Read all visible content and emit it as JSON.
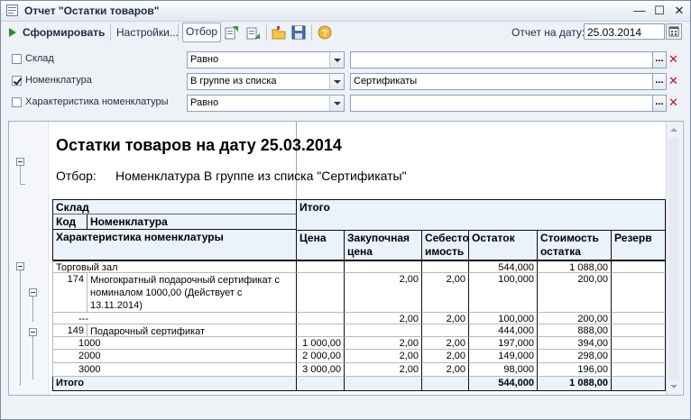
{
  "window": {
    "title": "Отчет \"Остатки товаров\"",
    "buttons": {
      "min": "—",
      "max": "☐",
      "close": "✕"
    }
  },
  "toolbar": {
    "form_label": "Сформировать",
    "settings_label": "Настройки...",
    "filter_label": "Отбор",
    "date_label": "Отчет на дату:",
    "date_value": "25.03.2014"
  },
  "filters": [
    {
      "checked": false,
      "label": "Склад",
      "comparison": "Равно",
      "value": ""
    },
    {
      "checked": true,
      "label": "Номенклатура",
      "comparison": "В группе из списка",
      "value": "Сертификаты"
    },
    {
      "checked": false,
      "label": "Характеристика номенклатуры",
      "comparison": "Равно",
      "value": ""
    }
  ],
  "report": {
    "title": "Остатки товаров на дату 25.03.2014",
    "filter_label": "Отбор:",
    "filter_text": "Номенклатура В группе из списка \"Сертификаты\"",
    "headers": {
      "sklad": "Склад",
      "itogo": "Итого",
      "kod": "Код",
      "nomenklatura": "Номенклатура",
      "harakteristika": "Характеристика номенклатуры",
      "cena": "Цена",
      "zakup": "Закупочная цена",
      "sebest": "Себесто имость",
      "ostatok": "Остаток",
      "stoimost": "Стоимость остатка",
      "rezerv": "Резерв"
    },
    "rows": [
      {
        "label": "Торговый зал",
        "cena": "",
        "zakup": "",
        "sebest": "",
        "ostatok": "544,000",
        "stoimost": "1 088,00",
        "rezerv": ""
      },
      {
        "code": "174",
        "label": "Многократный подарочный сертификат с номиналом 1000,00 (Действует с 13.11.2014)",
        "cena": "",
        "zakup": "2,00",
        "sebest": "2,00",
        "ostatok": "100,000",
        "stoimost": "200,00",
        "rezerv": ""
      },
      {
        "label": "---",
        "cena": "",
        "zakup": "2,00",
        "sebest": "2,00",
        "ostatok": "100,000",
        "stoimost": "200,00",
        "rezerv": ""
      },
      {
        "code": "149",
        "label": "Подарочный сертификат",
        "cena": "",
        "zakup": "",
        "sebest": "",
        "ostatok": "444,000",
        "stoimost": "888,00",
        "rezerv": ""
      },
      {
        "label": "1000",
        "cena": "1 000,00",
        "zakup": "2,00",
        "sebest": "2,00",
        "ostatok": "197,000",
        "stoimost": "394,00",
        "rezerv": ""
      },
      {
        "label": "2000",
        "cena": "2 000,00",
        "zakup": "2,00",
        "sebest": "2,00",
        "ostatok": "149,000",
        "stoimost": "298,00",
        "rezerv": ""
      },
      {
        "label": "3000",
        "cena": "3 000,00",
        "zakup": "2,00",
        "sebest": "2,00",
        "ostatok": "98,000",
        "stoimost": "196,00",
        "rezerv": ""
      },
      {
        "label": "Итого",
        "cena": "",
        "zakup": "",
        "sebest": "",
        "ostatok": "544,000",
        "stoimost": "1 088,00",
        "rezerv": ""
      }
    ]
  }
}
